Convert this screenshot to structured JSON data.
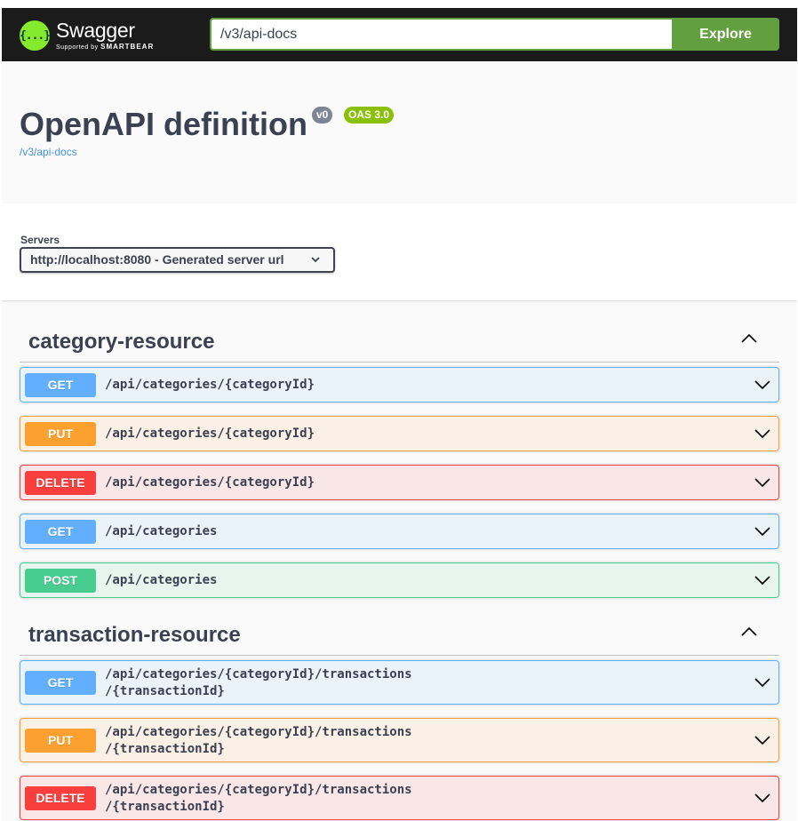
{
  "header": {
    "logo_name": "Swagger",
    "logo_sub_prefix": "Supported by",
    "logo_sub_brand": "SMARTBEAR",
    "logo_glyph": "{...}",
    "url_value": "/v3/api-docs",
    "explore_label": "Explore"
  },
  "info": {
    "title": "OpenAPI definition",
    "version_badge": "v0",
    "oas_badge": "OAS 3.0",
    "spec_link": "/v3/api-docs"
  },
  "servers": {
    "label": "Servers",
    "selected": "http://localhost:8080 - Generated server url"
  },
  "tags": [
    {
      "name": "category-resource",
      "expanded": true,
      "operations": [
        {
          "method": "GET",
          "path": "/api/categories/{categoryId}"
        },
        {
          "method": "PUT",
          "path": "/api/categories/{categoryId}"
        },
        {
          "method": "DELETE",
          "path": "/api/categories/{categoryId}"
        },
        {
          "method": "GET",
          "path": "/api/categories"
        },
        {
          "method": "POST",
          "path": "/api/categories"
        }
      ]
    },
    {
      "name": "transaction-resource",
      "expanded": true,
      "operations": [
        {
          "method": "GET",
          "path": "/api/categories/{categoryId}/transactions\n/{transactionId}"
        },
        {
          "method": "PUT",
          "path": "/api/categories/{categoryId}/transactions\n/{transactionId}"
        },
        {
          "method": "DELETE",
          "path": "/api/categories/{categoryId}/transactions\n/{transactionId}"
        }
      ]
    }
  ],
  "colors": {
    "get": "#61affe",
    "put": "#fca130",
    "delete": "#f93e3e",
    "post": "#49cc90",
    "explore": "#62a03f",
    "logo": "#85ea2d"
  }
}
